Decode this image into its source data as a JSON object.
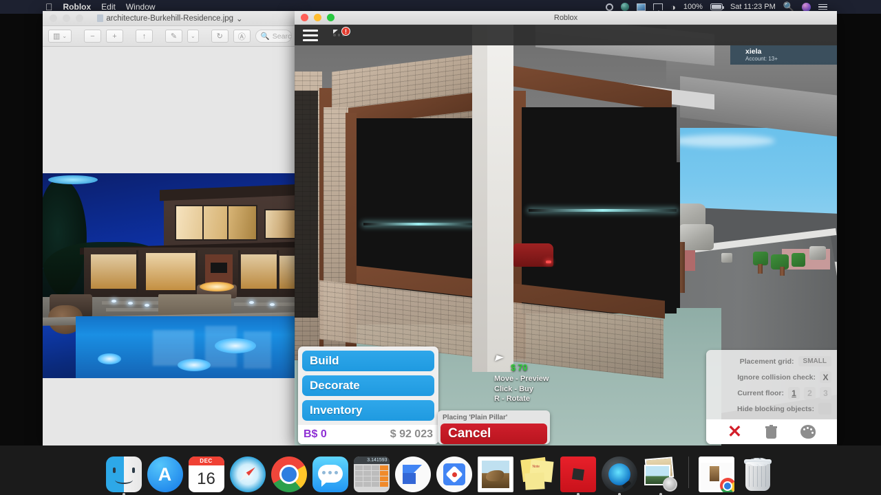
{
  "menubar": {
    "apple_icon": "apple-logo-icon",
    "items": [
      {
        "label": "Roblox",
        "bold": true
      },
      {
        "label": "Edit",
        "bold": false
      },
      {
        "label": "Window",
        "bold": false
      }
    ],
    "status": {
      "record_icon": "record-dot-icon",
      "control_icon": "control-center-icon",
      "screen_icon": "display-mirror-icon",
      "airplay_icon": "airplay-icon",
      "wifi_icon": "wifi-icon",
      "battery_percent": "100%",
      "battery_icon": "battery-charging-icon",
      "clock": "Sat 11:23 PM",
      "search_icon": "spotlight-search-icon",
      "siri_icon": "siri-icon",
      "notifications_icon": "notification-center-icon"
    }
  },
  "preview_window": {
    "title": "architecture-Burkehill-Residence.jpg",
    "doc_icon": "jpeg-document-icon",
    "title_chevron": "chevron-down-icon",
    "traffic": {
      "close": "close-icon",
      "minimize": "minimize-icon",
      "zoom": "zoom-icon"
    },
    "toolbar": {
      "sidebar_label": "▥",
      "sidebar_chevron": "⌄",
      "zoom_out": "−",
      "zoom_in": "+",
      "share": "↑",
      "markup": "✎",
      "markup_chevron": "⌄",
      "rotate": "↻",
      "annotate": "Ⓐ",
      "search_placeholder": "Search"
    },
    "image_alt": "architecture-Burkehill-Residence"
  },
  "roblox_window": {
    "title": "Roblox",
    "traffic": {
      "close": "close-icon",
      "minimize": "minimize-icon",
      "zoom": "zoom-icon"
    },
    "topbar": {
      "menu_icon": "hamburger-menu-icon",
      "chat_icon": "chat-bubble-icon",
      "chat_badge": "!"
    },
    "player": {
      "name": "xiela",
      "account": "Account: 13+"
    },
    "build_menu": {
      "buttons": [
        {
          "label": "Build"
        },
        {
          "label": "Decorate"
        },
        {
          "label": "Inventory"
        }
      ],
      "bucks": "B$ 0",
      "cash": "$ 92 023"
    },
    "placing_panel": {
      "label": "Placing 'Plain Pillar'",
      "cancel_label": "Cancel"
    },
    "cursor_hint": {
      "price": "$ 70",
      "lines": [
        "Move - Preview",
        "Click - Buy",
        "R - Rotate"
      ]
    },
    "settings": {
      "rows": [
        {
          "label": "Placement grid:",
          "value": "SMALL",
          "type": "value"
        },
        {
          "label": "Ignore collision check:",
          "value": "X",
          "type": "toggle"
        },
        {
          "label": "Current floor:",
          "value": "1",
          "options": [
            "1",
            "2",
            "3"
          ],
          "type": "floors"
        },
        {
          "label": "Hide blocking objects:",
          "value": "",
          "type": "blank"
        }
      ],
      "actions": [
        {
          "name": "delete-all-icon",
          "glyph": "✕"
        },
        {
          "name": "trash-icon",
          "glyph": ""
        },
        {
          "name": "palette-icon",
          "glyph": ""
        }
      ]
    },
    "colors": {
      "accent_blue": "#1f9ae0",
      "cancel_red": "#c9151f",
      "bucks_purple": "#8e2fd4",
      "price_green": "#2fd23a",
      "sky_blue": "#4fb4e8"
    }
  },
  "dock": {
    "items": [
      {
        "name": "finder",
        "label": "Finder",
        "running": true
      },
      {
        "name": "app-store",
        "label": "App Store",
        "running": false
      },
      {
        "name": "calendar",
        "label": "Calendar",
        "month": "DEC",
        "day": "16",
        "running": false
      },
      {
        "name": "safari",
        "label": "Safari",
        "running": false
      },
      {
        "name": "chrome",
        "label": "Google Chrome",
        "running": true
      },
      {
        "name": "messages",
        "label": "Messages",
        "running": false
      },
      {
        "name": "calculator",
        "label": "Calculator",
        "display": "3.141593",
        "running": false
      },
      {
        "name": "gbrand",
        "label": "Gmail",
        "running": false
      },
      {
        "name": "diamond-app",
        "label": "Google Drive",
        "running": false
      },
      {
        "name": "mail",
        "label": "Mail",
        "running": false
      },
      {
        "name": "stickies",
        "label": "Stickies",
        "running": false
      },
      {
        "name": "roblox",
        "label": "Roblox",
        "running": true
      },
      {
        "name": "quicktime",
        "label": "QuickTime Player",
        "running": true
      },
      {
        "name": "preview",
        "label": "Preview",
        "running": true
      },
      {
        "name": "minimized-window",
        "label": "Chrome Window",
        "running": false
      },
      {
        "name": "trash",
        "label": "Trash",
        "running": false
      }
    ]
  }
}
